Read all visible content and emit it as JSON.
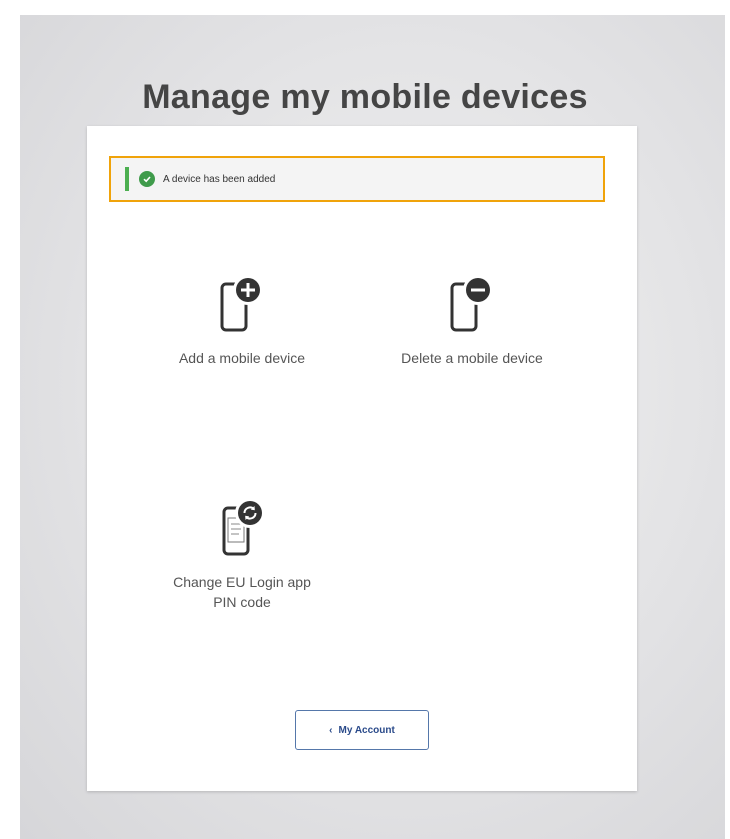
{
  "page": {
    "title": "Manage my mobile devices"
  },
  "notice": {
    "text": "A device has been added"
  },
  "options": [
    {
      "label": "Add a mobile device",
      "icon": "phone-add-icon"
    },
    {
      "label": "Delete a mobile device",
      "icon": "phone-remove-icon"
    },
    {
      "label": "Change EU Login app PIN code",
      "icon": "phone-pin-refresh-icon"
    }
  ],
  "footer": {
    "back_label": "My Account",
    "back_icon": "chevron-left-icon"
  },
  "colors": {
    "highlight": "#f0a30a",
    "success": "#3f9b4b",
    "link": "#2a4a8a"
  }
}
